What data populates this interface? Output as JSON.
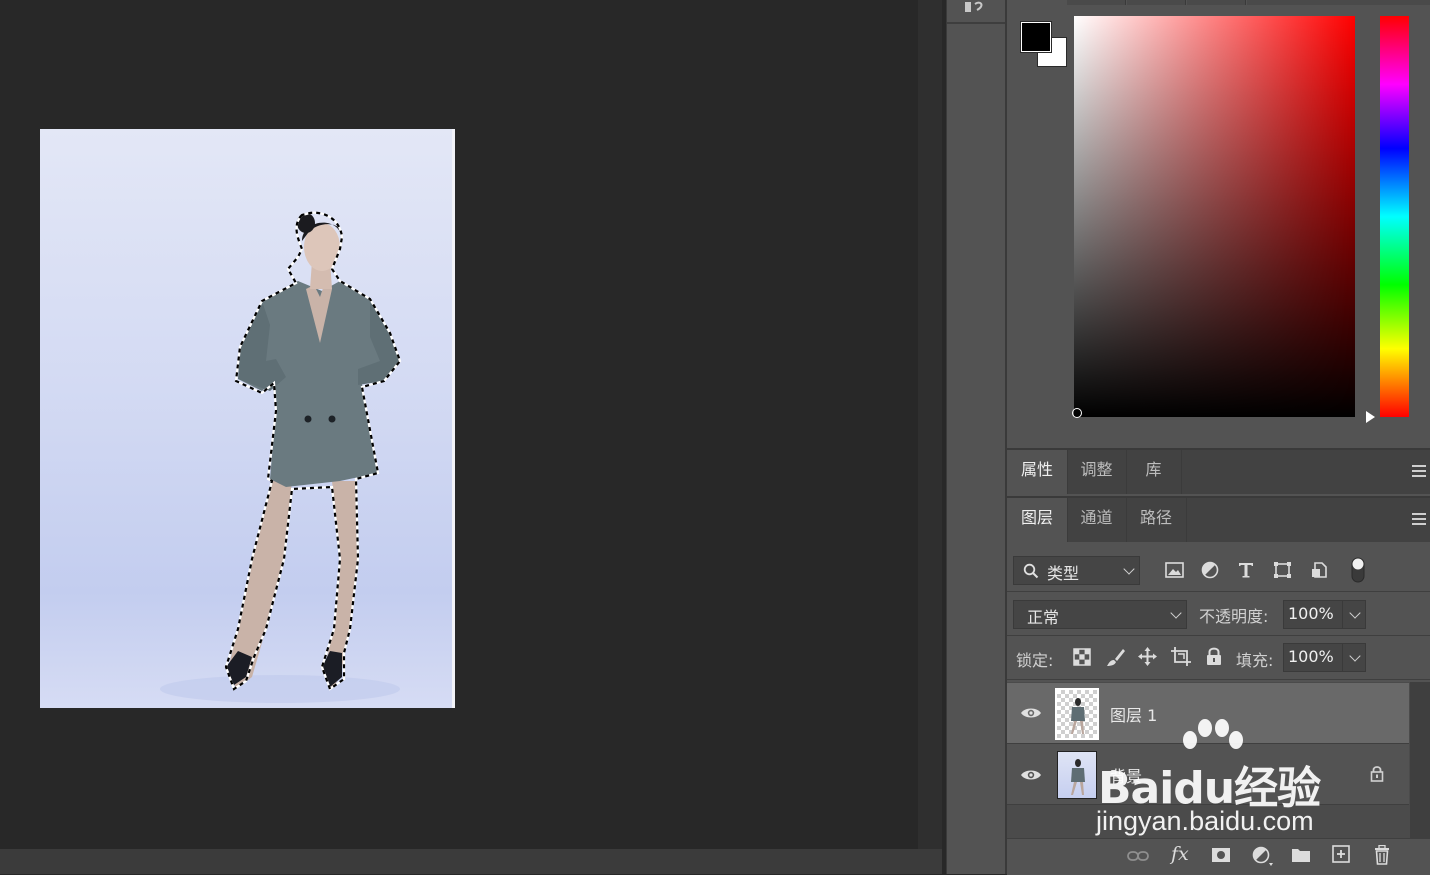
{
  "colors": {
    "foreground": "#000000",
    "background": "#ffffff",
    "panel": "#535353",
    "canvas_bg": "#282828"
  },
  "panels_top": {
    "tabs": [
      {
        "label": "属性",
        "active": true
      },
      {
        "label": "调整",
        "active": false
      },
      {
        "label": "库",
        "active": false
      }
    ]
  },
  "layers_panel": {
    "tabs": [
      {
        "label": "图层",
        "active": true
      },
      {
        "label": "通道",
        "active": false
      },
      {
        "label": "路径",
        "active": false
      }
    ],
    "filter": {
      "label": "类型",
      "icon": "search-icon"
    },
    "filter_icons": [
      "image-filter-icon",
      "adjustment-filter-icon",
      "type-filter-icon",
      "shape-filter-icon",
      "smart-object-filter-icon",
      "filter-toggle-icon"
    ],
    "blend_mode": "正常",
    "opacity_label": "不透明度:",
    "opacity_value": "100%",
    "lock_label": "锁定:",
    "lock_icons": [
      "lock-transparent-icon",
      "lock-pixels-icon",
      "lock-position-icon",
      "lock-artboard-icon",
      "lock-all-icon"
    ],
    "fill_label": "填充:",
    "fill_value": "100%",
    "layers": [
      {
        "name": "图层 1",
        "visible": true,
        "selected": true,
        "locked": false
      },
      {
        "name": "背景",
        "visible": true,
        "selected": false,
        "locked": true
      }
    ],
    "bottom_icons": [
      "link-icon",
      "fx-icon",
      "mask-icon",
      "adjustment-layer-icon",
      "group-folder-icon",
      "new-layer-icon",
      "trash-icon"
    ],
    "fx_label": "fx"
  },
  "watermark": {
    "main": "Baidu经验",
    "sub": "jingyan.baidu.com"
  }
}
